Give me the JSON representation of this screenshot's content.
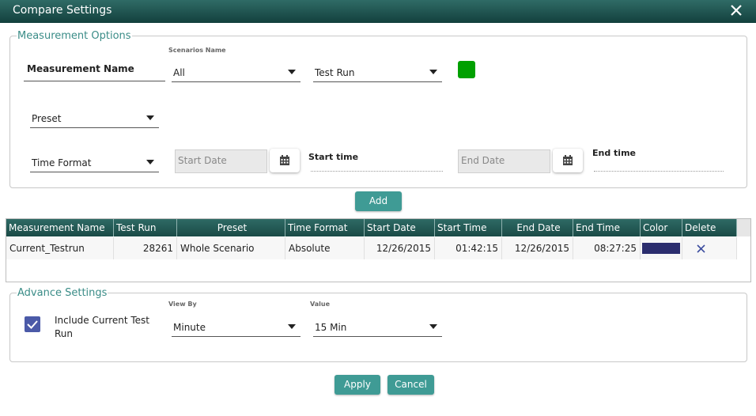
{
  "dialog": {
    "title": "Compare Settings"
  },
  "measurement_options": {
    "legend": "Measurement Options",
    "measurement_name_label": "Measurement Name",
    "scenarios_name_label": "Scenarios Name",
    "scenarios_value": "All",
    "test_run_value": "Test Run",
    "color_swatch": "#00a000",
    "preset_value": "Preset",
    "time_format_value": "Time Format",
    "start_date_placeholder": "Start Date",
    "start_time_label": "Start time",
    "end_date_placeholder": "End Date",
    "end_time_label": "End time",
    "add_label": "Add"
  },
  "grid": {
    "headers": [
      "Measurement Name",
      "Test Run",
      "Preset",
      "Time Format",
      "Start Date",
      "Start Time",
      "End Date",
      "End Time",
      "Color",
      "Delete"
    ],
    "rows": [
      {
        "measurement_name": "Current_Testrun",
        "test_run": "28261",
        "preset": "Whole Scenario",
        "time_format": "Absolute",
        "start_date": "12/26/2015",
        "start_time": "01:42:15",
        "end_date": "12/26/2015",
        "end_time": "08:27:25",
        "color": "#2b2d6e",
        "delete_icon": "close-icon"
      }
    ]
  },
  "advance_settings": {
    "legend": "Advance Settings",
    "include_current_label": "Include Current Test Run",
    "include_current_checked": true,
    "view_by_label": "View By",
    "view_by_value": "Minute",
    "value_label": "Value",
    "value_value": "15 Min"
  },
  "footer": {
    "apply_label": "Apply",
    "cancel_label": "Cancel"
  },
  "colors": {
    "accent": "#3f9b95",
    "header": "#1f4f4b"
  }
}
